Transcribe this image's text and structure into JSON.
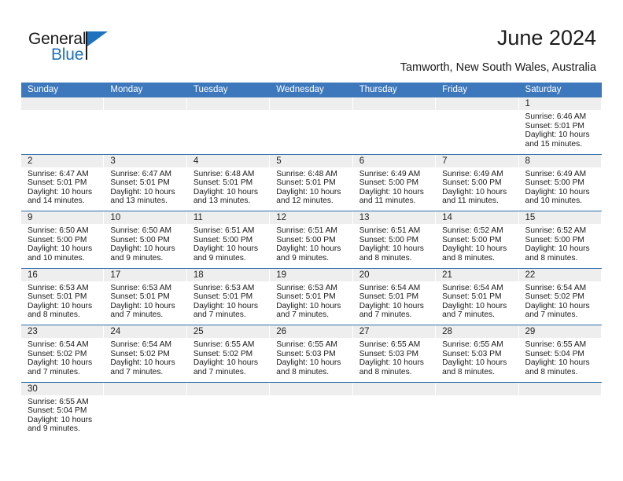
{
  "brand": {
    "name_top": "General",
    "name_bottom": "Blue",
    "accent_color": "#1f72bd"
  },
  "header": {
    "title": "June 2024",
    "subtitle": "Tamworth, New South Wales, Australia",
    "header_bg_color": "#3d78bc",
    "row_divider_color": "#2e6da8",
    "daynum_bg_color": "#eeeeee"
  },
  "weekdays": [
    "Sunday",
    "Monday",
    "Tuesday",
    "Wednesday",
    "Thursday",
    "Friday",
    "Saturday"
  ],
  "weeks": [
    [
      {
        "day": "",
        "sunrise": "",
        "sunset": "",
        "daylight_line1": "",
        "daylight_line2": ""
      },
      {
        "day": "",
        "sunrise": "",
        "sunset": "",
        "daylight_line1": "",
        "daylight_line2": ""
      },
      {
        "day": "",
        "sunrise": "",
        "sunset": "",
        "daylight_line1": "",
        "daylight_line2": ""
      },
      {
        "day": "",
        "sunrise": "",
        "sunset": "",
        "daylight_line1": "",
        "daylight_line2": ""
      },
      {
        "day": "",
        "sunrise": "",
        "sunset": "",
        "daylight_line1": "",
        "daylight_line2": ""
      },
      {
        "day": "",
        "sunrise": "",
        "sunset": "",
        "daylight_line1": "",
        "daylight_line2": ""
      },
      {
        "day": "1",
        "sunrise": "Sunrise: 6:46 AM",
        "sunset": "Sunset: 5:01 PM",
        "daylight_line1": "Daylight: 10 hours",
        "daylight_line2": "and 15 minutes."
      }
    ],
    [
      {
        "day": "2",
        "sunrise": "Sunrise: 6:47 AM",
        "sunset": "Sunset: 5:01 PM",
        "daylight_line1": "Daylight: 10 hours",
        "daylight_line2": "and 14 minutes."
      },
      {
        "day": "3",
        "sunrise": "Sunrise: 6:47 AM",
        "sunset": "Sunset: 5:01 PM",
        "daylight_line1": "Daylight: 10 hours",
        "daylight_line2": "and 13 minutes."
      },
      {
        "day": "4",
        "sunrise": "Sunrise: 6:48 AM",
        "sunset": "Sunset: 5:01 PM",
        "daylight_line1": "Daylight: 10 hours",
        "daylight_line2": "and 13 minutes."
      },
      {
        "day": "5",
        "sunrise": "Sunrise: 6:48 AM",
        "sunset": "Sunset: 5:01 PM",
        "daylight_line1": "Daylight: 10 hours",
        "daylight_line2": "and 12 minutes."
      },
      {
        "day": "6",
        "sunrise": "Sunrise: 6:49 AM",
        "sunset": "Sunset: 5:00 PM",
        "daylight_line1": "Daylight: 10 hours",
        "daylight_line2": "and 11 minutes."
      },
      {
        "day": "7",
        "sunrise": "Sunrise: 6:49 AM",
        "sunset": "Sunset: 5:00 PM",
        "daylight_line1": "Daylight: 10 hours",
        "daylight_line2": "and 11 minutes."
      },
      {
        "day": "8",
        "sunrise": "Sunrise: 6:49 AM",
        "sunset": "Sunset: 5:00 PM",
        "daylight_line1": "Daylight: 10 hours",
        "daylight_line2": "and 10 minutes."
      }
    ],
    [
      {
        "day": "9",
        "sunrise": "Sunrise: 6:50 AM",
        "sunset": "Sunset: 5:00 PM",
        "daylight_line1": "Daylight: 10 hours",
        "daylight_line2": "and 10 minutes."
      },
      {
        "day": "10",
        "sunrise": "Sunrise: 6:50 AM",
        "sunset": "Sunset: 5:00 PM",
        "daylight_line1": "Daylight: 10 hours",
        "daylight_line2": "and 9 minutes."
      },
      {
        "day": "11",
        "sunrise": "Sunrise: 6:51 AM",
        "sunset": "Sunset: 5:00 PM",
        "daylight_line1": "Daylight: 10 hours",
        "daylight_line2": "and 9 minutes."
      },
      {
        "day": "12",
        "sunrise": "Sunrise: 6:51 AM",
        "sunset": "Sunset: 5:00 PM",
        "daylight_line1": "Daylight: 10 hours",
        "daylight_line2": "and 9 minutes."
      },
      {
        "day": "13",
        "sunrise": "Sunrise: 6:51 AM",
        "sunset": "Sunset: 5:00 PM",
        "daylight_line1": "Daylight: 10 hours",
        "daylight_line2": "and 8 minutes."
      },
      {
        "day": "14",
        "sunrise": "Sunrise: 6:52 AM",
        "sunset": "Sunset: 5:00 PM",
        "daylight_line1": "Daylight: 10 hours",
        "daylight_line2": "and 8 minutes."
      },
      {
        "day": "15",
        "sunrise": "Sunrise: 6:52 AM",
        "sunset": "Sunset: 5:00 PM",
        "daylight_line1": "Daylight: 10 hours",
        "daylight_line2": "and 8 minutes."
      }
    ],
    [
      {
        "day": "16",
        "sunrise": "Sunrise: 6:53 AM",
        "sunset": "Sunset: 5:01 PM",
        "daylight_line1": "Daylight: 10 hours",
        "daylight_line2": "and 8 minutes."
      },
      {
        "day": "17",
        "sunrise": "Sunrise: 6:53 AM",
        "sunset": "Sunset: 5:01 PM",
        "daylight_line1": "Daylight: 10 hours",
        "daylight_line2": "and 7 minutes."
      },
      {
        "day": "18",
        "sunrise": "Sunrise: 6:53 AM",
        "sunset": "Sunset: 5:01 PM",
        "daylight_line1": "Daylight: 10 hours",
        "daylight_line2": "and 7 minutes."
      },
      {
        "day": "19",
        "sunrise": "Sunrise: 6:53 AM",
        "sunset": "Sunset: 5:01 PM",
        "daylight_line1": "Daylight: 10 hours",
        "daylight_line2": "and 7 minutes."
      },
      {
        "day": "20",
        "sunrise": "Sunrise: 6:54 AM",
        "sunset": "Sunset: 5:01 PM",
        "daylight_line1": "Daylight: 10 hours",
        "daylight_line2": "and 7 minutes."
      },
      {
        "day": "21",
        "sunrise": "Sunrise: 6:54 AM",
        "sunset": "Sunset: 5:01 PM",
        "daylight_line1": "Daylight: 10 hours",
        "daylight_line2": "and 7 minutes."
      },
      {
        "day": "22",
        "sunrise": "Sunrise: 6:54 AM",
        "sunset": "Sunset: 5:02 PM",
        "daylight_line1": "Daylight: 10 hours",
        "daylight_line2": "and 7 minutes."
      }
    ],
    [
      {
        "day": "23",
        "sunrise": "Sunrise: 6:54 AM",
        "sunset": "Sunset: 5:02 PM",
        "daylight_line1": "Daylight: 10 hours",
        "daylight_line2": "and 7 minutes."
      },
      {
        "day": "24",
        "sunrise": "Sunrise: 6:54 AM",
        "sunset": "Sunset: 5:02 PM",
        "daylight_line1": "Daylight: 10 hours",
        "daylight_line2": "and 7 minutes."
      },
      {
        "day": "25",
        "sunrise": "Sunrise: 6:55 AM",
        "sunset": "Sunset: 5:02 PM",
        "daylight_line1": "Daylight: 10 hours",
        "daylight_line2": "and 7 minutes."
      },
      {
        "day": "26",
        "sunrise": "Sunrise: 6:55 AM",
        "sunset": "Sunset: 5:03 PM",
        "daylight_line1": "Daylight: 10 hours",
        "daylight_line2": "and 8 minutes."
      },
      {
        "day": "27",
        "sunrise": "Sunrise: 6:55 AM",
        "sunset": "Sunset: 5:03 PM",
        "daylight_line1": "Daylight: 10 hours",
        "daylight_line2": "and 8 minutes."
      },
      {
        "day": "28",
        "sunrise": "Sunrise: 6:55 AM",
        "sunset": "Sunset: 5:03 PM",
        "daylight_line1": "Daylight: 10 hours",
        "daylight_line2": "and 8 minutes."
      },
      {
        "day": "29",
        "sunrise": "Sunrise: 6:55 AM",
        "sunset": "Sunset: 5:04 PM",
        "daylight_line1": "Daylight: 10 hours",
        "daylight_line2": "and 8 minutes."
      }
    ],
    [
      {
        "day": "30",
        "sunrise": "Sunrise: 6:55 AM",
        "sunset": "Sunset: 5:04 PM",
        "daylight_line1": "Daylight: 10 hours",
        "daylight_line2": "and 9 minutes."
      },
      {
        "day": "",
        "sunrise": "",
        "sunset": "",
        "daylight_line1": "",
        "daylight_line2": ""
      },
      {
        "day": "",
        "sunrise": "",
        "sunset": "",
        "daylight_line1": "",
        "daylight_line2": ""
      },
      {
        "day": "",
        "sunrise": "",
        "sunset": "",
        "daylight_line1": "",
        "daylight_line2": ""
      },
      {
        "day": "",
        "sunrise": "",
        "sunset": "",
        "daylight_line1": "",
        "daylight_line2": ""
      },
      {
        "day": "",
        "sunrise": "",
        "sunset": "",
        "daylight_line1": "",
        "daylight_line2": ""
      },
      {
        "day": "",
        "sunrise": "",
        "sunset": "",
        "daylight_line1": "",
        "daylight_line2": ""
      }
    ]
  ]
}
